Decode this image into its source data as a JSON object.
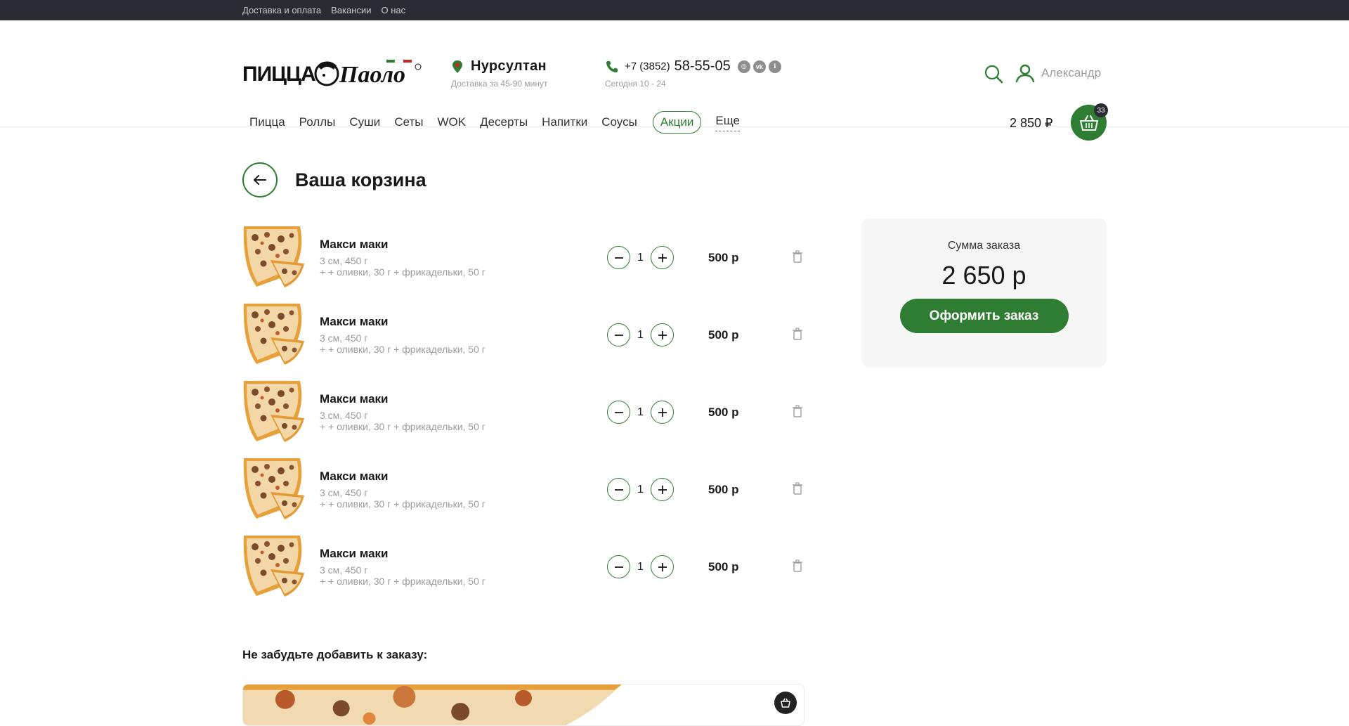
{
  "topbar": {
    "links": [
      "Доставка и оплата",
      "Вакансии",
      "О нас"
    ]
  },
  "header": {
    "city": "Нурсултан",
    "delivery_time": "Доставка за 45-90 минут",
    "phone_prefix": "+7 (3852)",
    "phone_number": "58-55-05",
    "hours": "Сегодня 10 - 24",
    "user_name": "Александр",
    "cart_sum": "2 850 ₽",
    "cart_count": "33"
  },
  "nav": {
    "items": [
      "Пицца",
      "Роллы",
      "Суши",
      "Сеты",
      "WOK",
      "Десерты",
      "Напитки",
      "Соусы"
    ],
    "promo": "Акции",
    "more": "Еще"
  },
  "page": {
    "title": "Ваша корзина"
  },
  "cart_items": [
    {
      "name": "Макси маки",
      "size": "3 см, 450 г",
      "extras": "+ + оливки, 30 г + фрикадельки, 50 г",
      "qty": "1",
      "price": "500 р"
    },
    {
      "name": "Макси маки",
      "size": "3 см, 450 г",
      "extras": "+ + оливки, 30 г + фрикадельки, 50 г",
      "qty": "1",
      "price": "500 р"
    },
    {
      "name": "Макси маки",
      "size": "3 см, 450 г",
      "extras": "+ + оливки, 30 г + фрикадельки, 50 г",
      "qty": "1",
      "price": "500 р"
    },
    {
      "name": "Макси маки",
      "size": "3 см, 450 г",
      "extras": "+ + оливки, 30 г + фрикадельки, 50 г",
      "qty": "1",
      "price": "500 р"
    },
    {
      "name": "Макси маки",
      "size": "3 см, 450 г",
      "extras": "+ + оливки, 30 г + фрикадельки, 50 г",
      "qty": "1",
      "price": "500 р"
    }
  ],
  "summary": {
    "label": "Сумма заказа",
    "total": "2 650 р",
    "checkout_label": "Оформить заказ"
  },
  "upsell": {
    "title": "Не забудьте добавить к заказу:"
  },
  "colors": {
    "accent": "#2e7d32",
    "topbar": "#2b2c33",
    "summary_bg": "#f6f6f6",
    "muted_text": "#9c9c9c"
  },
  "icons": {
    "search": "search-icon",
    "user": "user-icon",
    "cart": "basket-icon",
    "back": "arrow-left-icon",
    "trash": "trash-icon",
    "location": "location-pin-icon",
    "phone": "phone-icon"
  }
}
